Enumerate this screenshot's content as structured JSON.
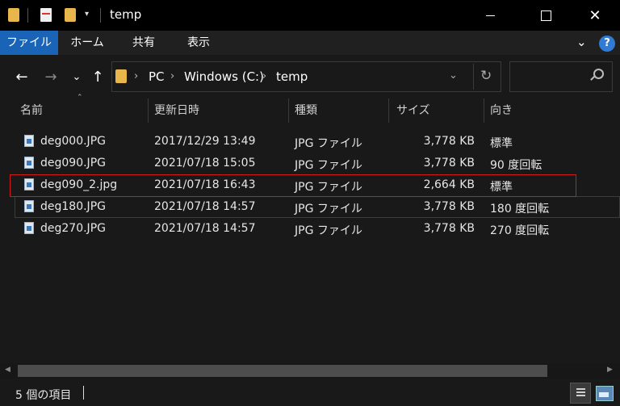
{
  "window": {
    "title": "temp",
    "controls": [
      "minimize-icon",
      "maximize-icon",
      "close-icon"
    ]
  },
  "quick_access": {
    "icons": [
      "folder-icon",
      "properties-icon",
      "new-folder-icon",
      "dropdown-icon"
    ]
  },
  "ribbon": {
    "tabs": [
      "ファイル",
      "ホーム",
      "共有",
      "表示"
    ],
    "active_tab": "ファイル",
    "accent_color": "#1a64b8"
  },
  "navigation": {
    "breadcrumbs": [
      "PC",
      "Windows (C:)",
      "temp"
    ]
  },
  "columns": [
    "名前",
    "更新日時",
    "種類",
    "サイズ",
    "向き"
  ],
  "files": [
    {
      "name": "deg000.JPG",
      "date": "2017/12/29 13:49",
      "type": "JPG ファイル",
      "size": "3,778 KB",
      "orientation": "標準"
    },
    {
      "name": "deg090.JPG",
      "date": "2021/07/18 15:05",
      "type": "JPG ファイル",
      "size": "3,778 KB",
      "orientation": "90 度回転"
    },
    {
      "name": "deg090_2.jpg",
      "date": "2021/07/18 16:43",
      "type": "JPG ファイル",
      "size": "2,664 KB",
      "orientation": "標準"
    },
    {
      "name": "deg180.JPG",
      "date": "2021/07/18 14:57",
      "type": "JPG ファイル",
      "size": "3,778 KB",
      "orientation": "180 度回転"
    },
    {
      "name": "deg270.JPG",
      "date": "2021/07/18 14:57",
      "type": "JPG ファイル",
      "size": "3,778 KB",
      "orientation": "270 度回転"
    }
  ],
  "status": {
    "item_count": "5 個の項目"
  },
  "highlight_color": "#d11a1a"
}
